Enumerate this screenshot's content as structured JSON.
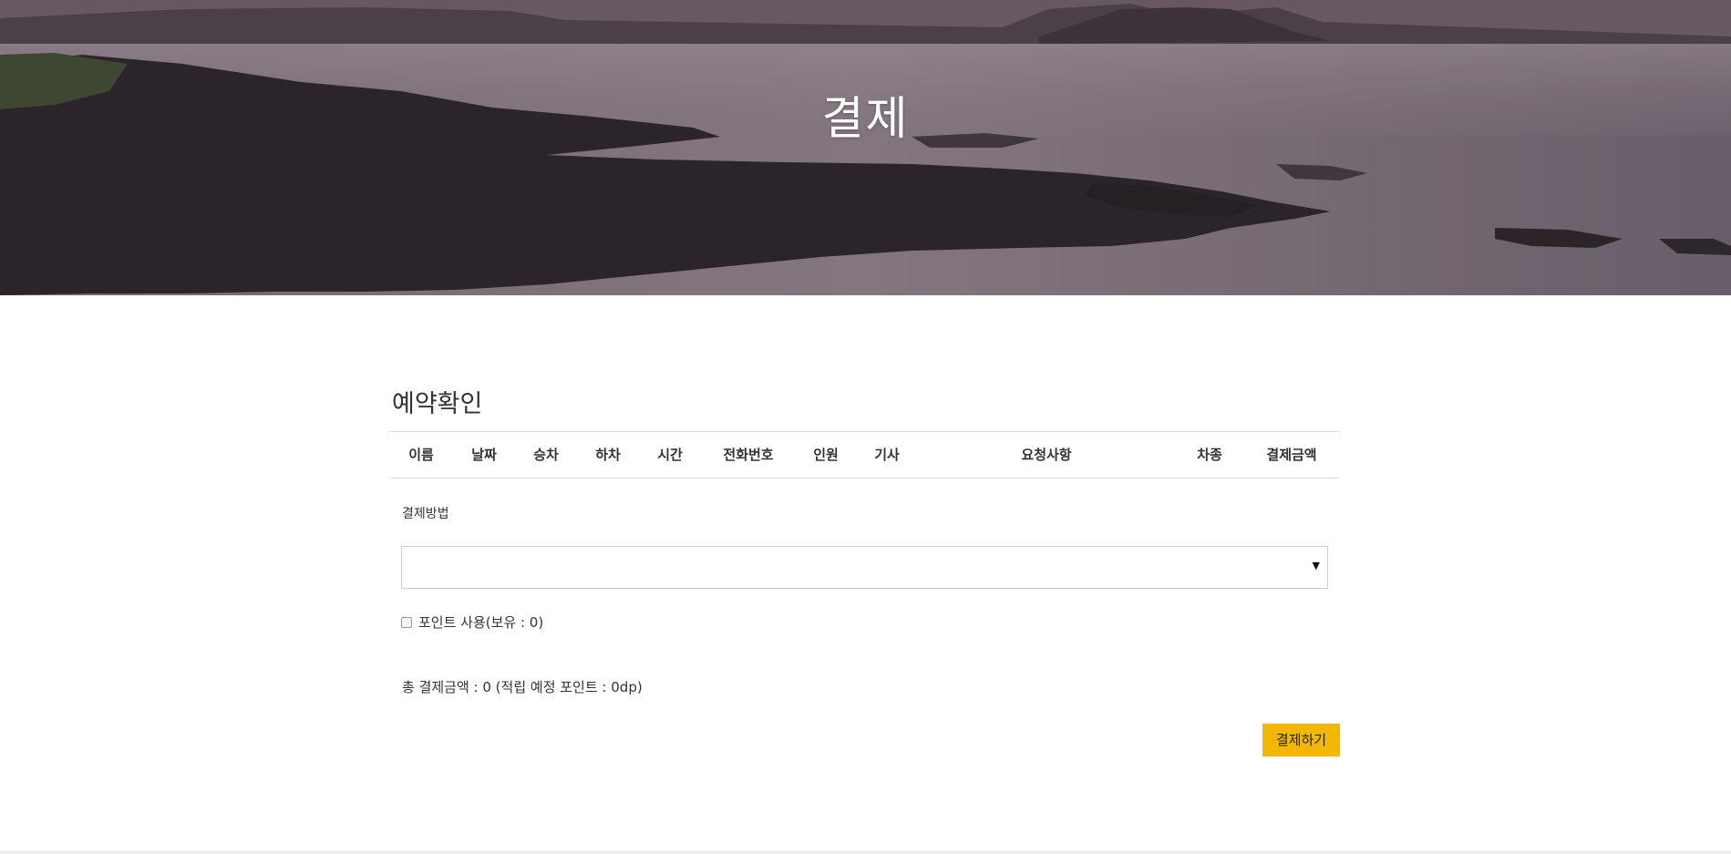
{
  "hero": {
    "title": "결제"
  },
  "section": {
    "title": "예약확인"
  },
  "table": {
    "columns": [
      "이름",
      "날짜",
      "승차",
      "하차",
      "시간",
      "전화번호",
      "인원",
      "기사",
      "요청사항",
      "차종",
      "결제금액"
    ]
  },
  "payment": {
    "method_label": "결제방법",
    "method_selected": "",
    "point_label": "포인트 사용(보유 : 0)",
    "point_checked": false,
    "total_text": "총 결제금액 : 0 (적립 예정 포인트 : 0dp)",
    "pay_button_label": "결제하기"
  },
  "colors": {
    "accent": "#f5b800",
    "hero_overlay": "#5a4a58"
  }
}
